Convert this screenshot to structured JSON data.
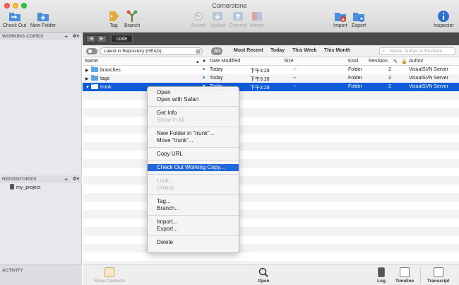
{
  "window": {
    "title": "Cornerstone"
  },
  "toolbar": {
    "check_out": "Check Out",
    "new_folder": "New Folder",
    "tag": "Tag",
    "branch": "Branch",
    "revert": "Revert",
    "update": "Update",
    "commit": "Commit",
    "merge": "Merge",
    "import": "Import",
    "export": "Export",
    "inspector": "Inspector"
  },
  "sidebar": {
    "working_copies": "WORKING COPIES",
    "repositories": "REPOSITORIES",
    "repo_item": "my_project",
    "activity": "ACTIVITY",
    "plus": "+",
    "gear": "✲▾"
  },
  "pathbar": {
    "back": "◀",
    "forward": "▶",
    "path": "code"
  },
  "filters": {
    "repo_scope": "Latest in Repository (HEAD)",
    "all": "All",
    "most_recent": "Most Recent",
    "today": "Today",
    "this_week": "This Week",
    "this_month": "This Month",
    "search_placeholder": "Name, Author or Revision"
  },
  "table": {
    "columns": {
      "name": "Name",
      "date": "Date Modified",
      "size": "Size",
      "kind": "Kind",
      "revision": "Revision",
      "author": "Author"
    },
    "rows": [
      {
        "name": "branches",
        "date": "Today",
        "time": "下午3:28",
        "size": "--",
        "kind": "Folder",
        "revision": "2",
        "author": "VisualSVN Server"
      },
      {
        "name": "tags",
        "date": "Today",
        "time": "下午3:28",
        "size": "--",
        "kind": "Folder",
        "revision": "2",
        "author": "VisualSVN Server"
      },
      {
        "name": "trunk",
        "date": "Today",
        "time": "下午3:28",
        "size": "--",
        "kind": "Folder",
        "revision": "2",
        "author": "VisualSVN Server"
      }
    ]
  },
  "context_menu": {
    "open": "Open",
    "open_with_safari": "Open with Safari",
    "get_info": "Get Info",
    "show_in_all": "Show in All",
    "new_folder_in": "New Folder in “trunk”...",
    "move": "Move “trunk”...",
    "copy_url": "Copy URL",
    "check_out_working_copy": "Check Out Working Copy...",
    "lock": "Lock...",
    "unlock": "Unlock",
    "tag": "Tag...",
    "branch": "Branch...",
    "import": "Import...",
    "export": "Export...",
    "delete": "Delete"
  },
  "bottom": {
    "show_contents": "Show Contents",
    "open": "Open",
    "log": "Log",
    "timeline": "Timeline",
    "transcript": "Transcript"
  },
  "colors": {
    "selection": "#0f5bd9",
    "menu_highlight": "#2266dc",
    "folder": "#5aa7e8"
  }
}
